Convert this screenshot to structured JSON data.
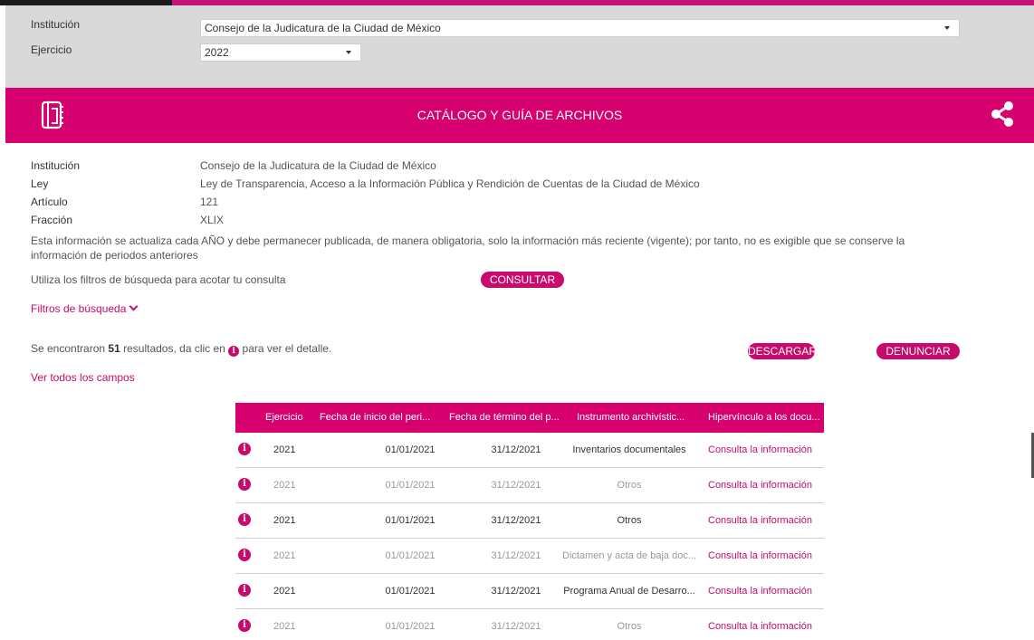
{
  "filters": {
    "institucion_label": "Institución",
    "institucion_value": "Consejo de la Judicatura de la Ciudad de México",
    "ejercicio_label": "Ejercicio",
    "ejercicio_value": "2022"
  },
  "header": {
    "title": "CATÁLOGO Y GUÍA DE ARCHIVOS"
  },
  "details": {
    "institucion_label": "Institución",
    "institucion_value": "Consejo de la Judicatura de la Ciudad de México",
    "ley_label": "Ley",
    "ley_value": "Ley de Transparencia, Acceso a la Información Pública y Rendición de Cuentas de la Ciudad de México",
    "articulo_label": "Artículo",
    "articulo_value": "121",
    "fraccion_label": "Fracción",
    "fraccion_value": "XLIX",
    "notice": "Esta información se actualiza cada AÑO y debe permanecer publicada, de manera obligatoria, solo la información más reciente (vigente); por tanto, no es exigible que se conserve la información de periodos anteriores"
  },
  "search": {
    "hint": "Utiliza los filtros de búsqueda para acotar tu consulta",
    "consultar_label": "CONSULTAR",
    "filters_link": "Filtros de búsqueda"
  },
  "results": {
    "prefix": "Se encontraron",
    "count": "51",
    "middle": "resultados, da clic en",
    "suffix": "para ver el detalle.",
    "descargar_label": "DESCARGAR",
    "denunciar_label": "DENUNCIAR",
    "view_all": "Ver todos los campos"
  },
  "table": {
    "columns": [
      "Ejercicio",
      "Fecha de inicio del peri...",
      "Fecha de término del p...",
      "Instrumento archivístic...",
      "Hipervínculo a los docu..."
    ],
    "rows": [
      [
        "2021",
        "01/01/2021",
        "31/12/2021",
        "Inventarios documentales",
        "Consulta la información"
      ],
      [
        "2021",
        "01/01/2021",
        "31/12/2021",
        "Otros",
        "Consulta la información"
      ],
      [
        "2021",
        "01/01/2021",
        "31/12/2021",
        "Otros",
        "Consulta la información"
      ],
      [
        "2021",
        "01/01/2021",
        "31/12/2021",
        "Dictamen y acta de baja doc...",
        "Consulta la información"
      ],
      [
        "2021",
        "01/01/2021",
        "31/12/2021",
        "Programa Anual de Desarro...",
        "Consulta la información"
      ],
      [
        "2021",
        "01/01/2021",
        "31/12/2021",
        "Otros",
        "Consulta la información"
      ]
    ]
  },
  "colors": {
    "accent": "#d6006f",
    "link": "#c70a6b",
    "filter_bg": "#d9d9d9"
  },
  "icons": {
    "header_left": "book-icon",
    "header_right": "share-icon",
    "row_info": "info-icon",
    "chevron": "chevron-down-icon"
  }
}
